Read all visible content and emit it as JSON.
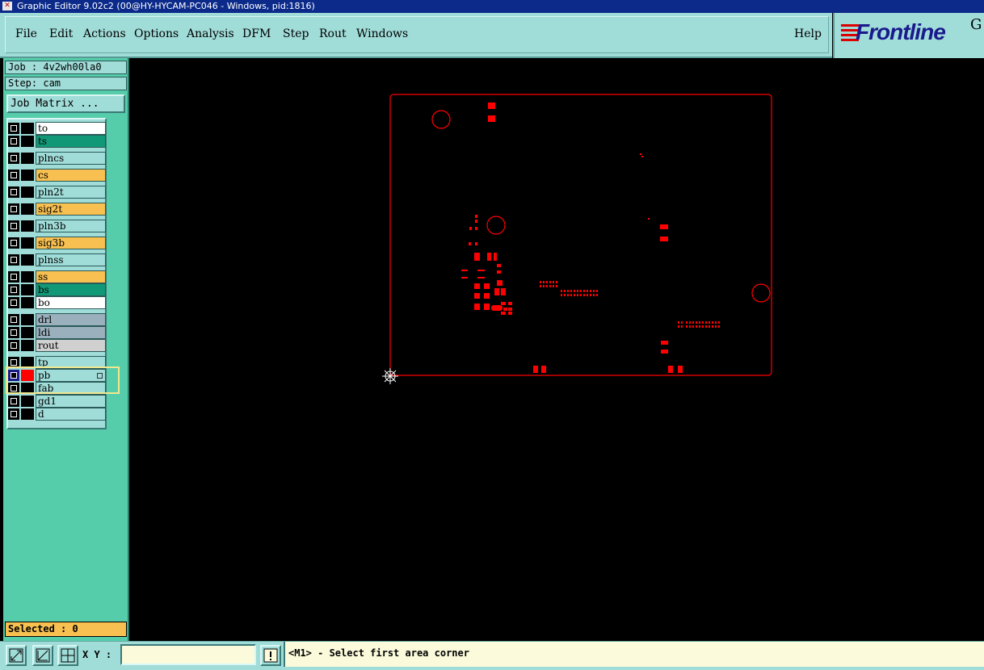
{
  "window": {
    "title": "Graphic Editor 9.02c2 (00@HY-HYCAM-PC046 - Windows, pid:1816)"
  },
  "menu": {
    "items": [
      "File",
      "Edit",
      "Actions",
      "Options",
      "Analysis",
      "DFM",
      "Step",
      "Rout",
      "Windows"
    ],
    "help": "Help"
  },
  "logo": {
    "text": "Frontline",
    "suffix": "G"
  },
  "job": {
    "job_label": "Job : 4v2wh00la0",
    "step_label": "Step: cam",
    "matrix_button": "Job Matrix ..."
  },
  "layers": [
    {
      "name": "to",
      "color": "#ffffff"
    },
    {
      "name": "ts",
      "color": "#119977"
    },
    {
      "name": "plncs",
      "color": "#a0dcd8"
    },
    {
      "name": "cs",
      "color": "#f8c050"
    },
    {
      "name": "pln2t",
      "color": "#a0dcd8"
    },
    {
      "name": "sig2t",
      "color": "#f8c050"
    },
    {
      "name": "pln3b",
      "color": "#a0dcd8"
    },
    {
      "name": "sig3b",
      "color": "#f8c050"
    },
    {
      "name": "plnss",
      "color": "#a0dcd8"
    },
    {
      "name": "ss",
      "color": "#f8c050"
    },
    {
      "name": "bs",
      "color": "#119977"
    },
    {
      "name": "bo",
      "color": "#ffffff"
    },
    {
      "name": "drl",
      "color": "#9ab0bc"
    },
    {
      "name": "ldi",
      "color": "#9ab0bc"
    },
    {
      "name": "rout",
      "color": "#d0d0d0"
    },
    {
      "name": "tp",
      "color": "#a0dcd8"
    },
    {
      "name": "pb",
      "color": "#a0dcd8"
    },
    {
      "name": "fab",
      "color": "#a0dcd8"
    },
    {
      "name": "gd1",
      "color": "#a0dcd8"
    },
    {
      "name": "d",
      "color": "#a0dcd8"
    }
  ],
  "active_layer": "pb",
  "selected": "Selected : 0",
  "status": {
    "xy_label": "X Y :",
    "xy_value": "",
    "message": "<M1> - Select first area corner"
  },
  "colors": {
    "feature": "#ff0000",
    "panel": "#a0dcd8",
    "panel_dark": "#55ccaa",
    "canvas": "#000000"
  }
}
